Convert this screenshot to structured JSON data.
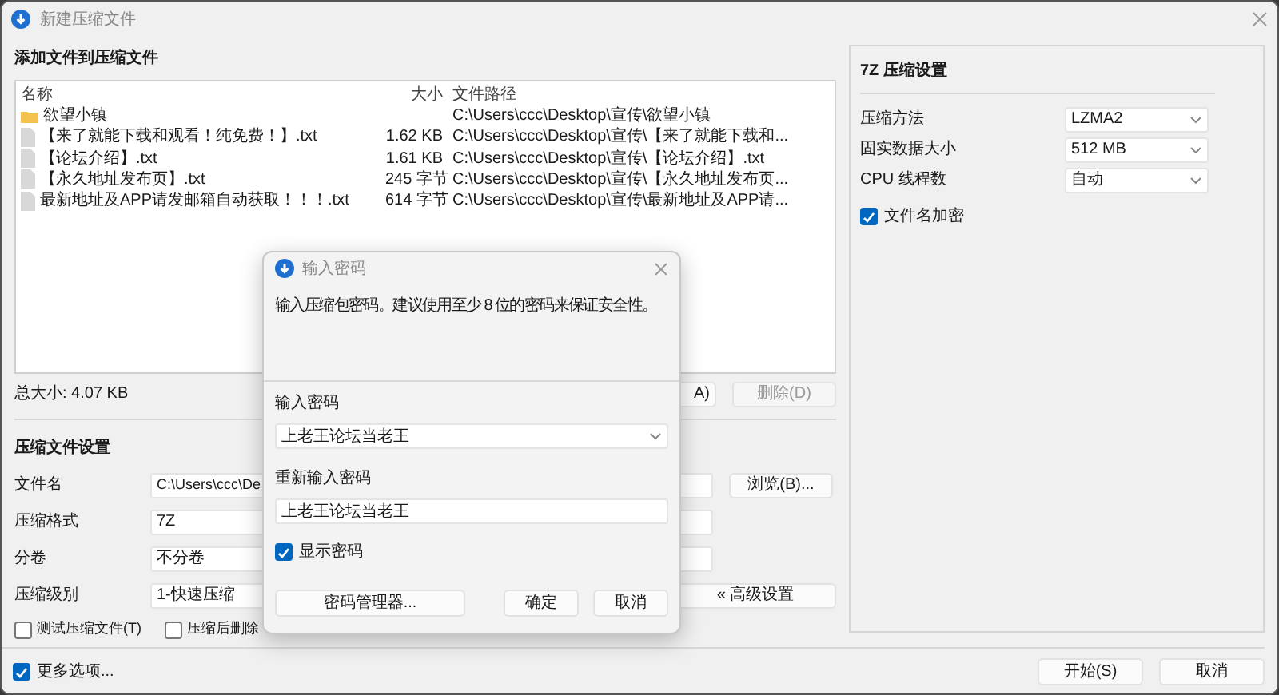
{
  "window": {
    "title": "新建压缩文件"
  },
  "files": {
    "heading": "添加文件到压缩文件",
    "columns": [
      "名称",
      "大小",
      "文件路径"
    ],
    "rows": [
      {
        "kind": "folder",
        "name": "欲望小镇",
        "path": "C:\\Users\\ccc\\Desktop\\宣传\\欲望小镇"
      },
      {
        "kind": "file",
        "name": "【来了就能下载和观看！纯免费！】.txt",
        "size": "1.62 KB",
        "path": "C:\\Users\\ccc\\Desktop\\宣传\\【来了就能下载和..."
      },
      {
        "kind": "file",
        "name": "【论坛介绍】.txt",
        "size": "1.61 KB",
        "path": "C:\\Users\\ccc\\Desktop\\宣传\\【论坛介绍】.txt"
      },
      {
        "kind": "file",
        "name": "【永久地址发布页】.txt",
        "size": "245 字节",
        "path": "C:\\Users\\ccc\\Desktop\\宣传\\【永久地址发布页..."
      },
      {
        "kind": "file",
        "name": "最新地址及APP请发邮箱自动获取！！！.txt",
        "size": "614 字节",
        "path": "C:\\Users\\ccc\\Desktop\\宣传\\最新地址及APP请..."
      }
    ]
  },
  "total_size": "总大小: 4.07 KB",
  "list_buttons": [
    {
      "label": "A)",
      "disabled": false
    },
    {
      "label": "删除(D)",
      "disabled": true
    }
  ],
  "settings": {
    "heading": "压缩文件设置",
    "fields": [
      {
        "label": "文件名",
        "value": "C:\\Users\\ccc\\De"
      },
      {
        "label": "压缩格式",
        "value": "7Z"
      },
      {
        "label": "分卷",
        "value": "不分卷"
      },
      {
        "label": "压缩级别",
        "value": "1-快速压缩"
      }
    ],
    "browse": "浏览(B)...",
    "advanced": "« 高级设置",
    "checkboxes": [
      {
        "label": "测试压缩文件(T)",
        "checked": false
      },
      {
        "label": "压缩后删除",
        "checked": false
      }
    ]
  },
  "seven_z": {
    "heading": "7Z 压缩设置",
    "fields": [
      {
        "label": "压缩方法",
        "value": "LZMA2"
      },
      {
        "label": "固实数据大小",
        "value": "512 MB"
      },
      {
        "label": "CPU 线程数",
        "value": "自动"
      }
    ],
    "encrypt_names": {
      "label": "文件名加密",
      "checked": true
    }
  },
  "more_options": {
    "label": "更多选项...",
    "checked": true
  },
  "footer_buttons": [
    "开始(S)",
    "取消"
  ],
  "dialog": {
    "title": "输入密码",
    "message": "输入压缩包密码。建议使用至少 8 位的密码来保证安全性。",
    "password_label": "输入密码",
    "password": "上老王论坛当老王",
    "confirm_label": "重新输入密码",
    "confirm": "上老王论坛当老王",
    "show_password": {
      "label": "显示密码",
      "checked": true
    },
    "buttons": [
      "密码管理器...",
      "确定",
      "取消"
    ]
  }
}
